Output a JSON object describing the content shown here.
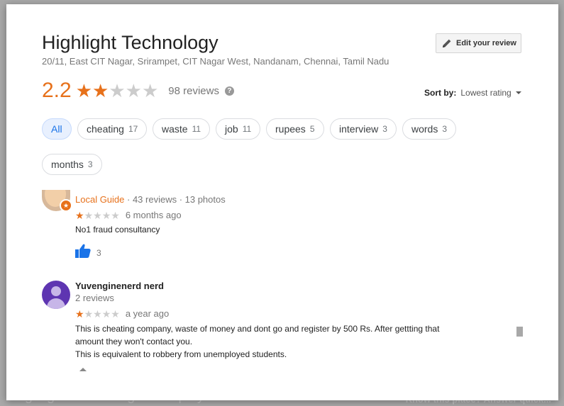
{
  "backdrop": {
    "bottom_text": "Highlight Technologies Employees Reviews ...",
    "bottom_right_text": "Know this place? Answer quick..."
  },
  "business": {
    "name": "Highlight Technology",
    "address": "20/11, East CIT Nagar, Srirampet, CIT Nagar West, Nandanam, Chennai, Tamil Nadu",
    "rating": "2.2",
    "rating_stars": 2,
    "review_count": "98 reviews"
  },
  "edit_review": {
    "label": "Edit your review"
  },
  "sort": {
    "label": "Sort by:",
    "value": "Lowest rating"
  },
  "filters": [
    {
      "label": "All",
      "count": ""
    },
    {
      "label": "cheating",
      "count": "17"
    },
    {
      "label": "waste",
      "count": "11"
    },
    {
      "label": "job",
      "count": "11"
    },
    {
      "label": "rupees",
      "count": "5"
    },
    {
      "label": "interview",
      "count": "3"
    },
    {
      "label": "words",
      "count": "3"
    },
    {
      "label": "months",
      "count": "3"
    }
  ],
  "reviews": [
    {
      "local_guide": "Local Guide",
      "meta": " · 43 reviews · 13 photos",
      "stars": 1,
      "when": "6 months ago",
      "text": "No1 fraud consultancy",
      "likes": "3"
    },
    {
      "name": "Yuvenginenerd nerd",
      "sub": "2 reviews",
      "stars": 1,
      "when": "a year ago",
      "text_lines": [
        "This is cheating company, waste of money and dont go and register by 500 Rs. After gettting that",
        "amount they won't contact you.",
        "This is equivalent to robbery from unemployed students."
      ]
    }
  ],
  "colors": {
    "accent_orange": "#e7711b",
    "star_empty": "#cccccc",
    "chip_active_bg": "#e8f0fe",
    "like_blue": "#1a73e8"
  },
  "icons": {
    "edit": "pencil-icon",
    "help": "help-icon",
    "like": "thumbs-up-icon",
    "sort": "caret-down-icon"
  }
}
